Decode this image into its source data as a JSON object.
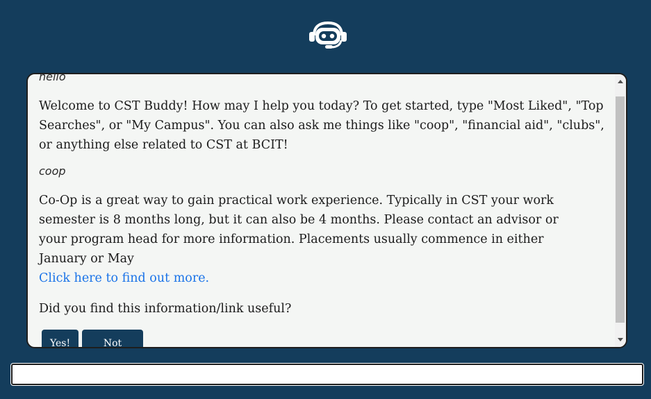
{
  "header": {
    "logo_icon": "chatbot-headset-icon"
  },
  "chat": {
    "messages": [
      {
        "role": "user",
        "text": "hello"
      },
      {
        "role": "bot",
        "text": "Welcome to CST Buddy! How may I help you today? To get started, type \"Most Liked\", \"Top Searches\", or \"My Campus\". You can also ask me things like \"coop\", \"financial aid\", \"clubs\", or anything else related to CST at BCIT!"
      },
      {
        "role": "user",
        "text": "coop"
      },
      {
        "role": "bot",
        "text": "Co-Op is a great way to gain practical work experience. Typically in CST your work semester is 8 months long, but it can also be 4 months. Please contact an advisor or your program head for more information. Placements usually commence in either January or May"
      }
    ],
    "link_text": "Click here to find out more.",
    "feedback_question": "Did you find this information/link useful?",
    "feedback_yes": "Yes!",
    "feedback_no": "Not really"
  },
  "input": {
    "value": "",
    "placeholder": ""
  },
  "colors": {
    "background": "#143d5c",
    "chat_panel": "#f4f6f4",
    "link": "#1a73e8",
    "button": "#143d5c"
  }
}
